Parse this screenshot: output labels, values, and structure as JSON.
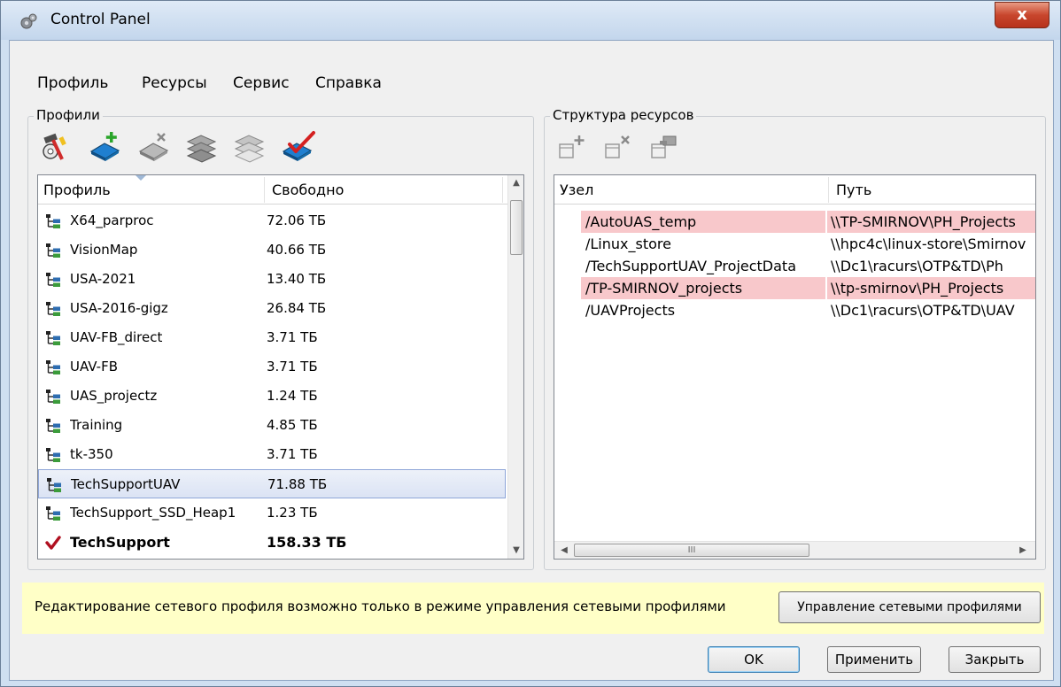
{
  "window": {
    "title": "Control Panel",
    "close_label": "x"
  },
  "menu": [
    "Профиль",
    "Ресурсы",
    "Сервис",
    "Справка"
  ],
  "profiles": {
    "group_title": "Профили",
    "toolbar_icons": [
      "network-settings-icon",
      "add-profile-icon",
      "remove-profile-icon",
      "profile-stack-icon",
      "profile-stack-disabled-icon",
      "set-active-profile-icon"
    ],
    "columns": [
      "Профиль",
      "Свободно"
    ],
    "rows": [
      {
        "name": "X64_parproc",
        "free": "72.06 ТБ",
        "icon": "network-tree-icon"
      },
      {
        "name": "VisionMap",
        "free": "40.66 ТБ",
        "icon": "network-tree-icon"
      },
      {
        "name": "USA-2021",
        "free": "13.40 ТБ",
        "icon": "network-tree-icon"
      },
      {
        "name": "USA-2016-gigz",
        "free": "26.84 ТБ",
        "icon": "network-tree-icon"
      },
      {
        "name": "UAV-FB_direct",
        "free": "3.71 ТБ",
        "icon": "network-tree-icon"
      },
      {
        "name": "UAV-FB",
        "free": "3.71 ТБ",
        "icon": "network-tree-icon"
      },
      {
        "name": "UAS_projectz",
        "free": "1.24 ТБ",
        "icon": "network-tree-icon"
      },
      {
        "name": "Training",
        "free": "4.85 ТБ",
        "icon": "network-tree-icon"
      },
      {
        "name": "tk-350",
        "free": "3.71 ТБ",
        "icon": "network-tree-icon"
      },
      {
        "name": "TechSupportUAV",
        "free": "71.88 ТБ",
        "icon": "network-tree-icon",
        "selected": true
      },
      {
        "name": "TechSupport_SSD_Heap1",
        "free": "1.23 ТБ",
        "icon": "network-tree-icon"
      },
      {
        "name": "TechSupport",
        "free": "158.33 ТБ",
        "icon": "check-mark-icon",
        "active": true
      }
    ]
  },
  "resources": {
    "group_title": "Структура ресурсов",
    "toolbar_icons": [
      "add-node-icon",
      "remove-node-icon",
      "edit-node-icon"
    ],
    "columns": [
      "Узел",
      "Путь"
    ],
    "rows": [
      {
        "node": "/AutoUAS_temp",
        "path": "\\\\TP-SMIRNOV\\PH_Projects",
        "highlight": true
      },
      {
        "node": "/Linux_store",
        "path": "\\\\hpc4c\\linux-store\\Smirnov",
        "highlight": false
      },
      {
        "node": "/TechSupportUAV_ProjectData",
        "path": "\\\\Dc1\\racurs\\OTP&TD\\Ph",
        "highlight": false
      },
      {
        "node": "/TP-SMIRNOV_projects",
        "path": "\\\\tp-smirnov\\PH_Projects",
        "highlight": true
      },
      {
        "node": "/UAVProjects",
        "path": "\\\\Dc1\\racurs\\OTP&TD\\UAV",
        "highlight": false
      }
    ],
    "hscroll_thumb": "III"
  },
  "info": {
    "message": "Редактирование сетевого профиля возможно только в режиме управления сетевыми профилями",
    "manage_button": "Управление сетевыми профилями"
  },
  "buttons": {
    "ok": "OK",
    "apply": "Применить",
    "close": "Закрыть"
  },
  "colors": {
    "highlight_pink": "#f8c8cb",
    "info_bg": "#ffffc7",
    "check_red": "#b01020",
    "selection": "#dbe3f4"
  }
}
